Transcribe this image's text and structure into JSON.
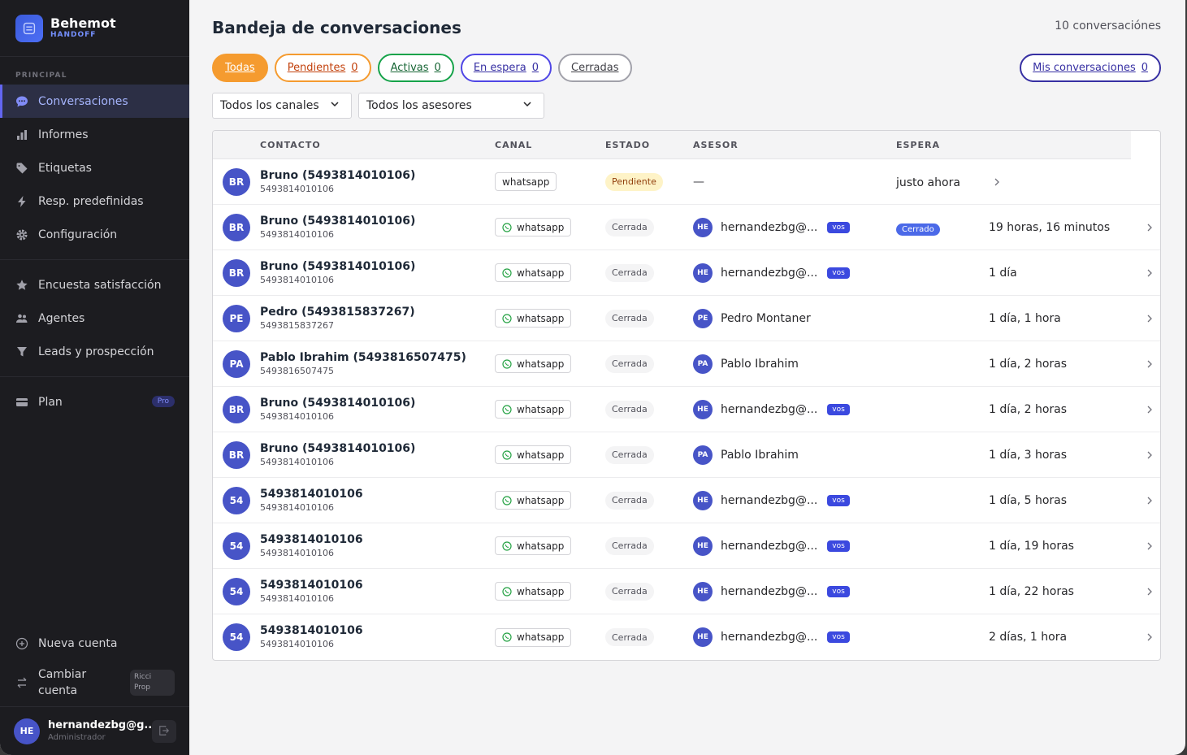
{
  "sidebar": {
    "brand": {
      "name": "Behemot",
      "sub": "HANDOFF"
    },
    "section_label": "PRINCIPAL",
    "items": [
      {
        "label": "Conversaciones",
        "icon": "chat-icon",
        "active": true
      },
      {
        "label": "Informes",
        "icon": "bar-chart-icon"
      },
      {
        "label": "Etiquetas",
        "icon": "tag-icon"
      },
      {
        "label": "Resp. predefinidas",
        "icon": "lightning-icon"
      },
      {
        "label": "Configuración",
        "icon": "gear-icon"
      },
      {
        "label": "Encuesta satisfacción",
        "icon": "star-icon"
      },
      {
        "label": "Agentes",
        "icon": "users-icon"
      },
      {
        "label": "Leads y prospección",
        "icon": "funnel-icon"
      },
      {
        "label": "Plan",
        "icon": "card-icon",
        "badge": "Pro"
      }
    ],
    "nueva_cuenta": "Nueva cuenta",
    "cambiar_cuenta": {
      "line1": "Cambiar",
      "line2": "cuenta",
      "chip_line1": "Ricci",
      "chip_line2": "Prop"
    },
    "user": {
      "initials": "HE",
      "name": "hernandezbg@g...",
      "role": "Administrador"
    }
  },
  "main": {
    "title": "Bandeja de conversaciones",
    "count": "10 conversaciónes",
    "filters": [
      {
        "label": "Todas",
        "count": ""
      },
      {
        "label": "Pendientes",
        "count": "0"
      },
      {
        "label": "Activas",
        "count": "0"
      },
      {
        "label": "En espera",
        "count": "0"
      },
      {
        "label": "Cerradas",
        "count": ""
      }
    ],
    "mis": {
      "label": "Mis conversaciones",
      "count": "0"
    },
    "selects": [
      "Todos los canales",
      "Todos los asesores"
    ],
    "columns": [
      "CONTACTO",
      "CANAL",
      "ESTADO",
      "ASESOR",
      "ESPERA"
    ],
    "rows": [
      {
        "initials": "BR",
        "name": "Bruno (5493814010106)",
        "phone": "5493814010106",
        "channel": "whatsapp",
        "channel_icon": false,
        "status": "Pendiente",
        "asesor_initials": "",
        "asesor": "—",
        "vos": "",
        "espera_tag": "",
        "time": "justo ahora"
      },
      {
        "initials": "BR",
        "name": "Bruno (5493814010106)",
        "phone": "5493814010106",
        "channel": "whatsapp",
        "channel_icon": true,
        "status": "Cerrada",
        "asesor_initials": "HE",
        "asesor": "hernandezbg@...",
        "vos": "vos",
        "espera_tag": "Cerrado",
        "time": "19 horas, 16 minutos"
      },
      {
        "initials": "BR",
        "name": "Bruno (5493814010106)",
        "phone": "5493814010106",
        "channel": "whatsapp",
        "channel_icon": true,
        "status": "Cerrada",
        "asesor_initials": "HE",
        "asesor": "hernandezbg@...",
        "vos": "vos",
        "espera_tag": "",
        "time": "1 día"
      },
      {
        "initials": "PE",
        "name": "Pedro (5493815837267)",
        "phone": "5493815837267",
        "channel": "whatsapp",
        "channel_icon": true,
        "status": "Cerrada",
        "asesor_initials": "PE",
        "asesor": "Pedro Montaner",
        "vos": "",
        "espera_tag": "",
        "time": "1 día, 1 hora"
      },
      {
        "initials": "PA",
        "name": "Pablo Ibrahim (5493816507475)",
        "phone": "5493816507475",
        "channel": "whatsapp",
        "channel_icon": true,
        "status": "Cerrada",
        "asesor_initials": "PA",
        "asesor": "Pablo Ibrahim",
        "vos": "",
        "espera_tag": "",
        "time": "1 día, 2 horas"
      },
      {
        "initials": "BR",
        "name": "Bruno (5493814010106)",
        "phone": "5493814010106",
        "channel": "whatsapp",
        "channel_icon": true,
        "status": "Cerrada",
        "asesor_initials": "HE",
        "asesor": "hernandezbg@...",
        "vos": "vos",
        "espera_tag": "",
        "time": "1 día, 2 horas"
      },
      {
        "initials": "BR",
        "name": "Bruno (5493814010106)",
        "phone": "5493814010106",
        "channel": "whatsapp",
        "channel_icon": true,
        "status": "Cerrada",
        "asesor_initials": "PA",
        "asesor": "Pablo Ibrahim",
        "vos": "",
        "espera_tag": "",
        "time": "1 día, 3 horas"
      },
      {
        "initials": "54",
        "name": "5493814010106",
        "phone": "5493814010106",
        "channel": "whatsapp",
        "channel_icon": true,
        "status": "Cerrada",
        "asesor_initials": "HE",
        "asesor": "hernandezbg@...",
        "vos": "vos",
        "espera_tag": "",
        "time": "1 día, 5 horas"
      },
      {
        "initials": "54",
        "name": "5493814010106",
        "phone": "5493814010106",
        "channel": "whatsapp",
        "channel_icon": true,
        "status": "Cerrada",
        "asesor_initials": "HE",
        "asesor": "hernandezbg@...",
        "vos": "vos",
        "espera_tag": "",
        "time": "1 día, 19 horas"
      },
      {
        "initials": "54",
        "name": "5493814010106",
        "phone": "5493814010106",
        "channel": "whatsapp",
        "channel_icon": true,
        "status": "Cerrada",
        "asesor_initials": "HE",
        "asesor": "hernandezbg@...",
        "vos": "vos",
        "espera_tag": "",
        "time": "1 día, 22 horas"
      },
      {
        "initials": "54",
        "name": "5493814010106",
        "phone": "5493814010106",
        "channel": "whatsapp",
        "channel_icon": true,
        "status": "Cerrada",
        "asesor_initials": "HE",
        "asesor": "hernandezbg@...",
        "vos": "vos",
        "espera_tag": "",
        "time": "2 días, 1 hora"
      }
    ]
  },
  "colors": {
    "accent": "#f59b2f",
    "primary": "#4754c7",
    "sidebar_bg": "#1c1c20",
    "whatsapp": "#25d366"
  }
}
